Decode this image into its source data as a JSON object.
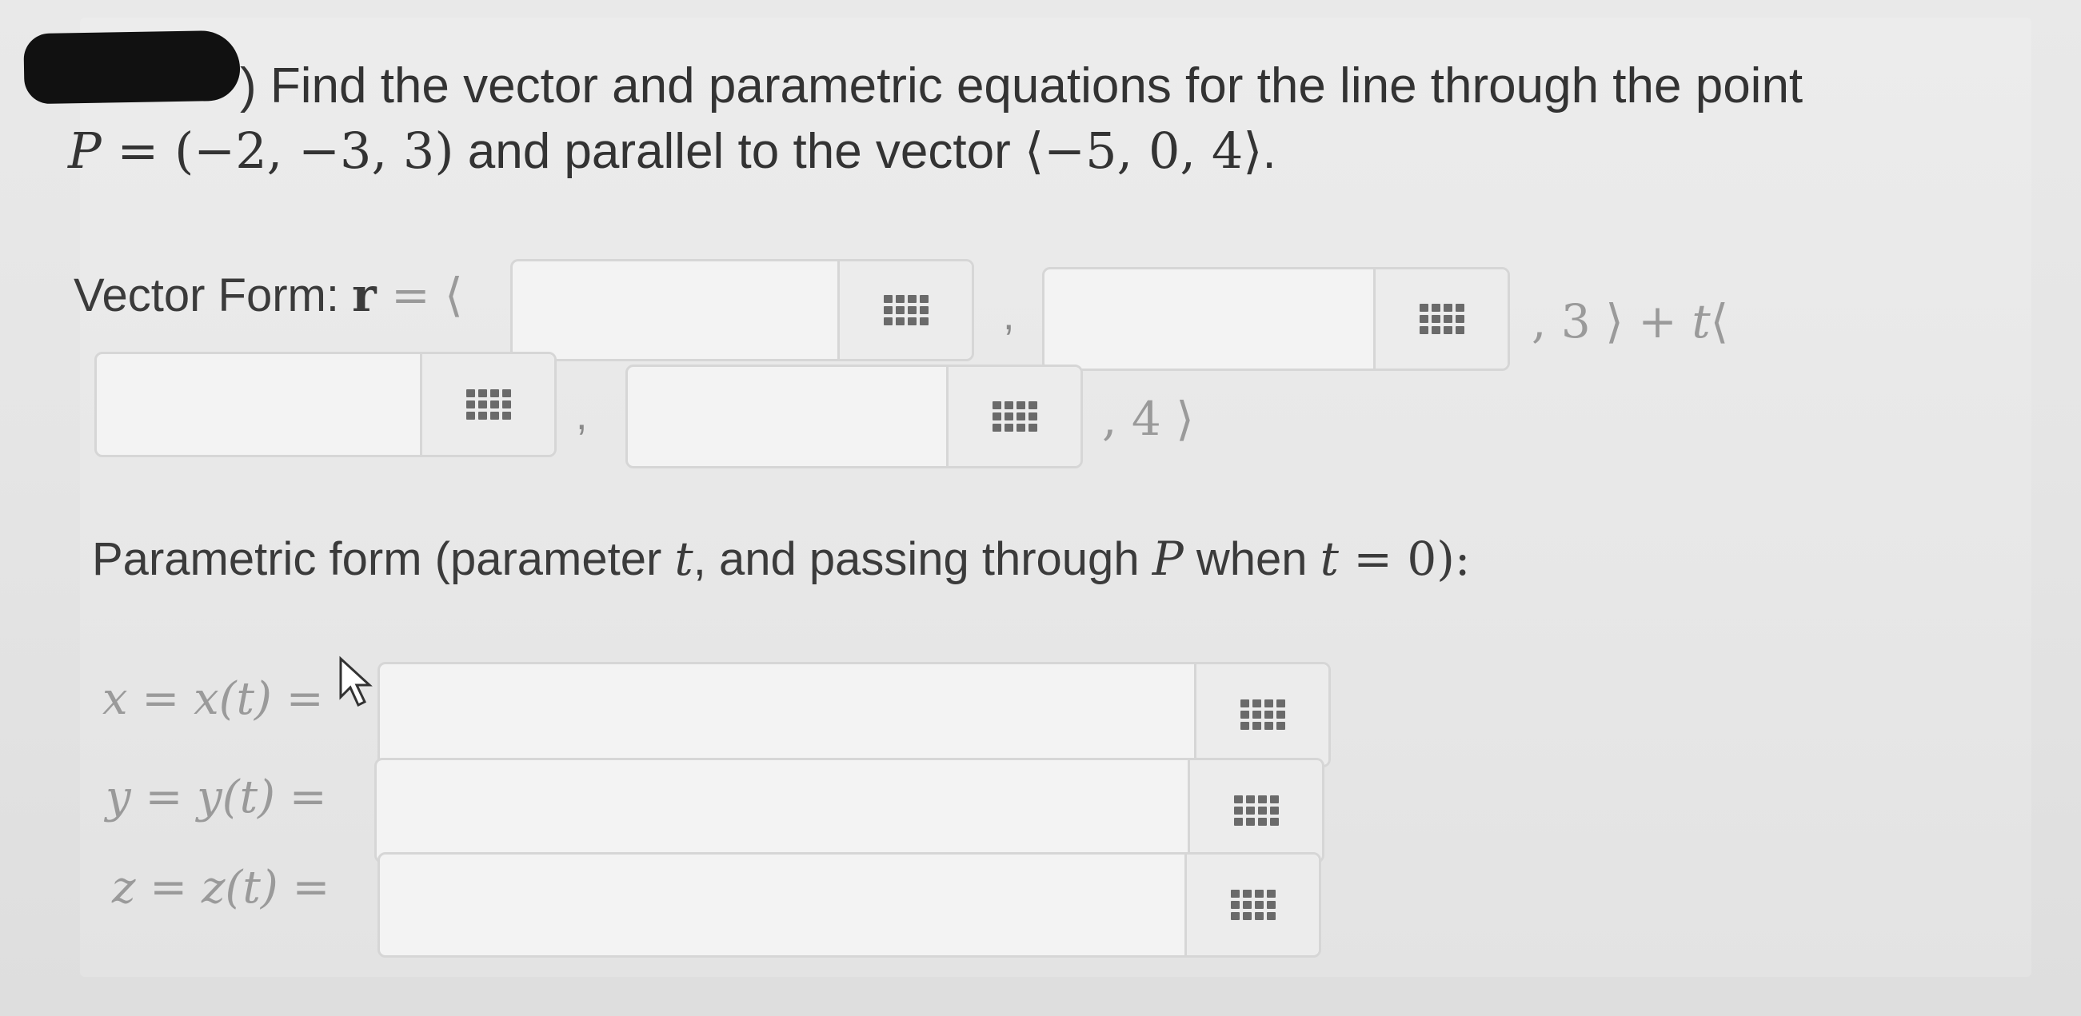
{
  "question": {
    "line1": ") Find the vector and parametric equations for the line through the point",
    "point_name": "P",
    "point_eq": " = (−2, −3, 3)",
    "mid_text": " and parallel to the vector ",
    "vector": "⟨−5, 0, 4⟩",
    "end": "."
  },
  "vector_form": {
    "label": "Vector Form: ",
    "r_symbol": "r",
    "eq_open": " = ⟨",
    "comma": ",",
    "after_row1": ", 3 ⟩ + ",
    "t": "t",
    "open_angle": "⟨",
    "after_row2": ", 4 ⟩"
  },
  "parametric": {
    "label_start": "Parametric form (parameter ",
    "t": "t",
    "label_mid": ", and passing through ",
    "P": "P",
    "label_when": " when ",
    "label_eq": " = 0):",
    "x_label": "x = x(t) =",
    "y_label": "y = y(t) =",
    "z_label": "z = z(t) ="
  },
  "fields": {
    "vf_x0": "",
    "vf_y0": "",
    "vf_dx": "",
    "vf_dy": "",
    "px": "",
    "py": "",
    "pz": ""
  },
  "icons": {
    "keypad": "keypad-icon",
    "cursor": "mouse-cursor-icon"
  }
}
